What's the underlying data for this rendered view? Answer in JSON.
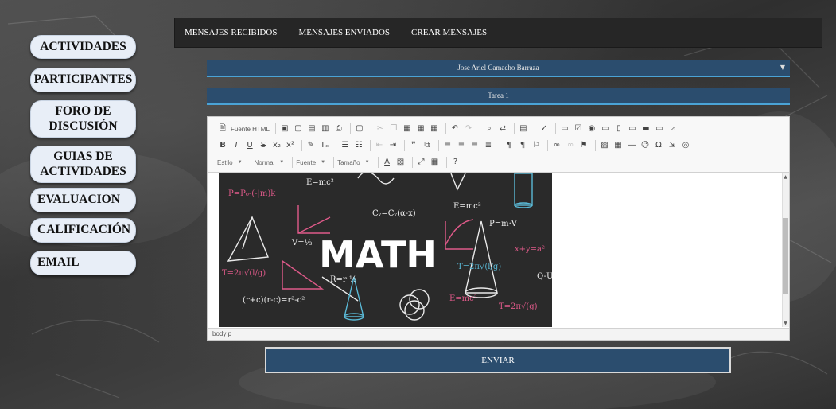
{
  "sidebar": {
    "items": [
      {
        "label": "ACTIVIDADES"
      },
      {
        "label": "PARTICIPANTES"
      },
      {
        "label": "FORO DE DISCUSIÓN"
      },
      {
        "label": "GUIAS DE ACTIVIDADES"
      },
      {
        "label": "EVALUACION"
      },
      {
        "label": "CALIFICACIÓN"
      },
      {
        "label": "EMAIL"
      }
    ]
  },
  "topnav": {
    "links": [
      {
        "label": "MENSAJES RECIBIDOS"
      },
      {
        "label": "MENSAJES ENVIADOS"
      },
      {
        "label": "CREAR MENSAJES"
      }
    ]
  },
  "form": {
    "recipient_select": "Jose Ariel Camacho Barraza",
    "subject_field": "Tarea 1",
    "send_label": "ENVIAR"
  },
  "editor": {
    "source_label": "Fuente HTML",
    "style_combo": "Estilo",
    "format_combo": "Normal",
    "font_combo": "Fuente",
    "size_combo": "Tamaño",
    "status_path": "body  p",
    "image": {
      "big_word": "MATH",
      "formulas": [
        "E=mc²",
        "E=mc²",
        "P=m·V",
        "V=⅓",
        "R=r·⅓",
        "Cᵥ=Cᵥ(α-x)",
        "(r+c)(r-c)=r²-c²",
        "P=P₀-(-|m)k",
        "T=2π√(l/g)",
        "T=2π√(l/g)",
        "x+y=a²",
        "Q-U",
        "E=mc²",
        "T=2π√(g)"
      ]
    }
  },
  "colors": {
    "accent": "#2b4d6e",
    "accent_border": "#4aa3d6",
    "nav_bg": "#262626",
    "sidebar_bg": "#e8eef7"
  }
}
